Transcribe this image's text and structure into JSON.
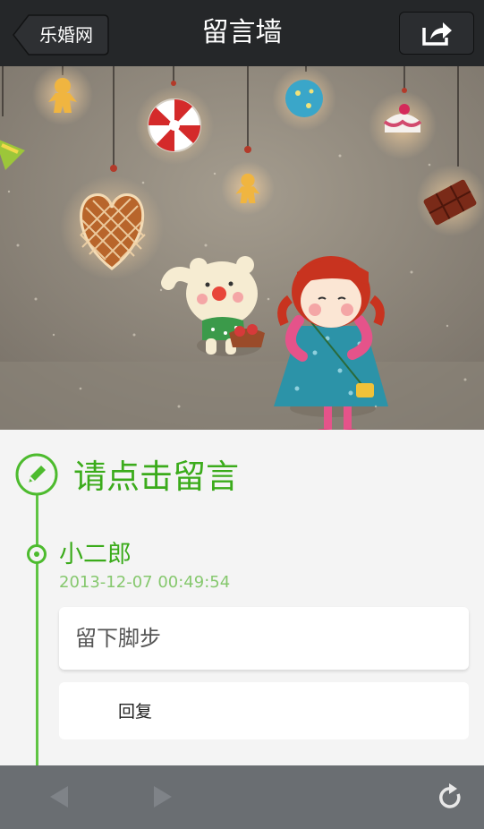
{
  "nav": {
    "back_label": "乐婚网",
    "title": "留言墙"
  },
  "content": {
    "prompt": "请点击留言",
    "entry": {
      "author": "小二郎",
      "timestamp": "2013-12-07 00:49:54",
      "message": "留下脚步",
      "reply_label": "回复"
    }
  },
  "colors": {
    "accent": "#3bab1b",
    "topbar": "#252729",
    "toolbar": "#6a6e72"
  }
}
